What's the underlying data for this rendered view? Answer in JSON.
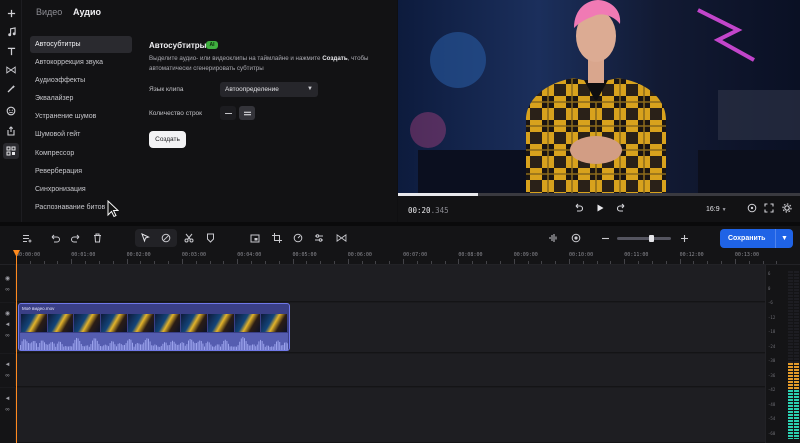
{
  "tabs": {
    "video": "Видео",
    "audio": "Аудио"
  },
  "sidebar_icons": [
    "plus-icon",
    "music-note-icon",
    "text-icon",
    "transitions-icon",
    "magic-wand-icon",
    "sticker-icon",
    "export-icon",
    "tools-grid-icon"
  ],
  "menu": {
    "items": [
      "Автосубтитры",
      "Автокоррекция звука",
      "Аудиоэффекты",
      "Эквалайзер",
      "Устранение шумов",
      "Шумовой гейт",
      "Компрессор",
      "Реверберация",
      "Синхронизация",
      "Распознавание битов"
    ]
  },
  "panel": {
    "title": "Автосубтитры",
    "badge": "AI",
    "description_before": "Выделите аудио- или видеоклипы на таймлайне и нажмите ",
    "description_bold": "Создать",
    "description_after": ", чтобы автоматически сгенерировать субтитры",
    "language_label": "Язык клипа",
    "language_value": "Автоопределение",
    "rows_label": "Количество строк",
    "create_button": "Создать"
  },
  "player": {
    "timecode_main": "00:20",
    "timecode_ms": ".345",
    "aspect_ratio": "16:9",
    "progress": 0.2
  },
  "toolbar": {
    "save_label": "Сохранить"
  },
  "ruler": [
    "00:00:00",
    "00:01:00",
    "00:02:00",
    "00:03:00",
    "00:04:00",
    "00:05:00",
    "00:06:00",
    "00:07:00",
    "00:08:00",
    "00:09:00",
    "00:10:00",
    "00:11:00",
    "00:12:00",
    "00:13:00"
  ],
  "clip": {
    "name": "Моё видео.mov"
  },
  "meter": {
    "scale": [
      "6",
      "0",
      "-6",
      "-12",
      "-18",
      "-24",
      "-30",
      "-36",
      "-42",
      "-48",
      "-54",
      "-60"
    ],
    "level_left": 0.45,
    "level_right": 0.45
  },
  "zoom": {
    "level": 0.6
  },
  "colors": {
    "accent": "#1f63e6",
    "playhead": "#ff8a1e",
    "clip": "#3a3f86",
    "badge": "#3fae3f"
  }
}
